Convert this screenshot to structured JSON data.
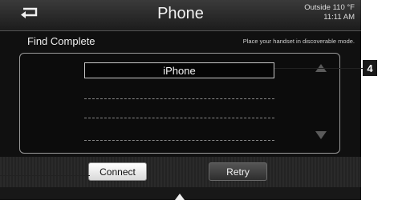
{
  "header": {
    "title": "Phone",
    "back_icon": "back-arrow-icon",
    "outside_label": "Outside 110 °F",
    "time": "11:11 AM"
  },
  "status": {
    "label": "Find Complete",
    "hint": "Place your handset in discoverable mode."
  },
  "device_list": {
    "items": [
      "iPhone",
      "",
      "",
      "",
      ""
    ],
    "selected": "iPhone"
  },
  "actions": {
    "connect_label": "Connect",
    "retry_label": "Retry"
  },
  "callouts": {
    "number": "4"
  }
}
